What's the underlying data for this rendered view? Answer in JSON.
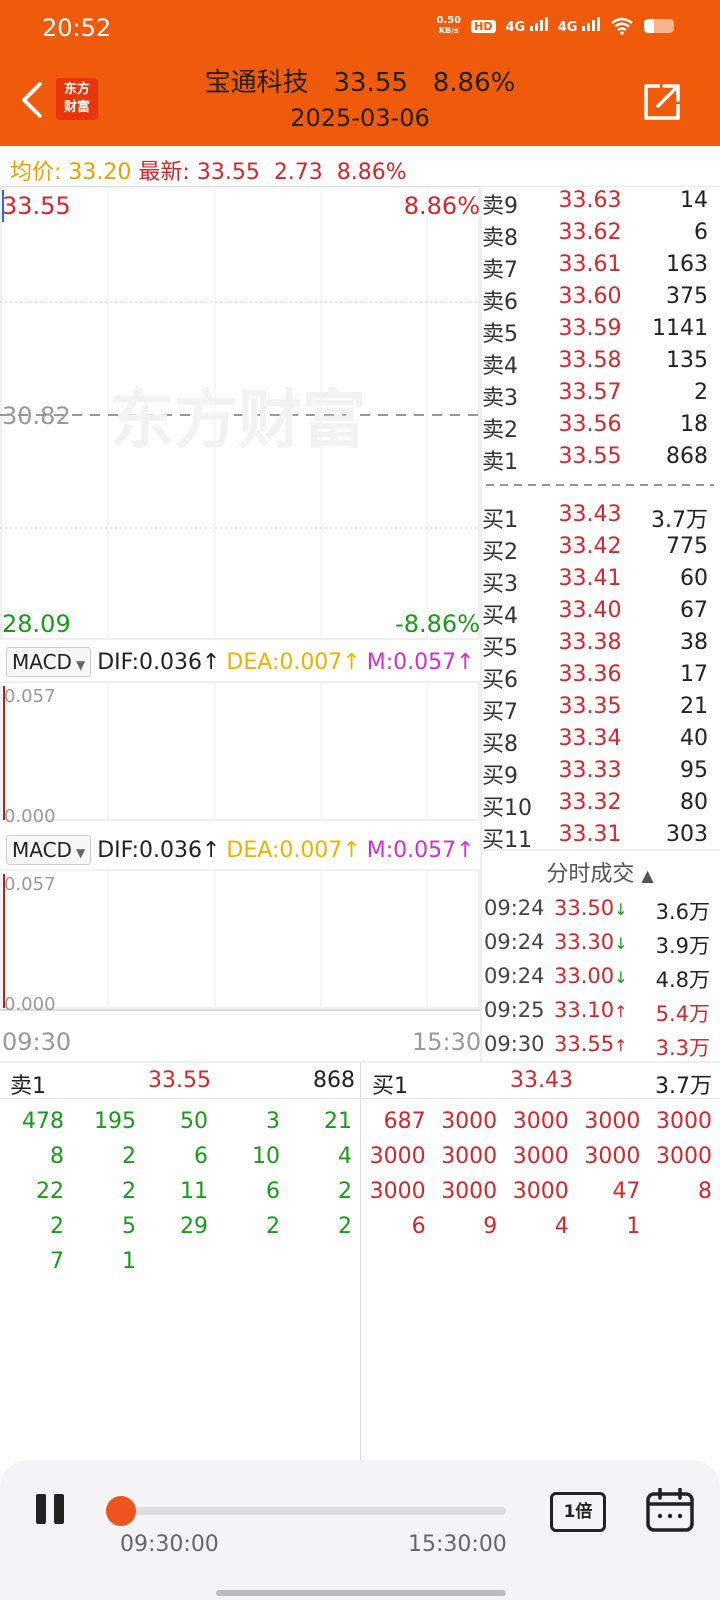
{
  "status": {
    "time": "20:52",
    "net_speed": "0.50",
    "net_unit": "KB/s",
    "hd_label": "HD",
    "sim_1": "4G",
    "sim_2": "4G"
  },
  "header": {
    "logo_line1": "东方",
    "logo_line2": "财富",
    "stock_name": "宝通科技",
    "price": "33.55",
    "change_pct": "8.86%",
    "date": "2025-03-06",
    "back_icon": "chevron-left-icon",
    "share_icon": "share-external-icon"
  },
  "infoline": {
    "avg_label": "均价:",
    "avg_value": "33.20",
    "latest_label": "最新:",
    "latest_value": "33.55",
    "change": "2.73",
    "change_pct": "8.86%"
  },
  "chart": {
    "watermark": "东方财富",
    "top_price": "33.55",
    "top_pct": "8.86%",
    "mid_price": "30.82",
    "low_price": "28.09",
    "low_pct": "-8.86%",
    "time_start": "09:30",
    "time_end": "15:30",
    "colors": {
      "up": "#d0282c",
      "down": "#1a9a1a",
      "avg": "#e8a100"
    }
  },
  "macd": [
    {
      "name": "MACD",
      "dif": "DIF:0.036",
      "dea": "DEA:0.007",
      "m": "M:0.057",
      "high": "0.057",
      "low": "0.000"
    },
    {
      "name": "MACD",
      "dif": "DIF:0.036",
      "dea": "DEA:0.007",
      "m": "M:0.057",
      "high": "0.057",
      "low": "0.000"
    }
  ],
  "order_book": {
    "asks": [
      {
        "label": "卖9",
        "price": "33.63",
        "vol": "14"
      },
      {
        "label": "卖8",
        "price": "33.62",
        "vol": "6"
      },
      {
        "label": "卖7",
        "price": "33.61",
        "vol": "163"
      },
      {
        "label": "卖6",
        "price": "33.60",
        "vol": "375"
      },
      {
        "label": "卖5",
        "price": "33.59",
        "vol": "1141"
      },
      {
        "label": "卖4",
        "price": "33.58",
        "vol": "135"
      },
      {
        "label": "卖3",
        "price": "33.57",
        "vol": "2"
      },
      {
        "label": "卖2",
        "price": "33.56",
        "vol": "18"
      },
      {
        "label": "卖1",
        "price": "33.55",
        "vol": "868"
      }
    ],
    "bids": [
      {
        "label": "买1",
        "price": "33.43",
        "vol": "3.7万"
      },
      {
        "label": "买2",
        "price": "33.42",
        "vol": "775"
      },
      {
        "label": "买3",
        "price": "33.41",
        "vol": "60"
      },
      {
        "label": "买4",
        "price": "33.40",
        "vol": "67"
      },
      {
        "label": "买5",
        "price": "33.38",
        "vol": "38"
      },
      {
        "label": "买6",
        "price": "33.36",
        "vol": "17"
      },
      {
        "label": "买7",
        "price": "33.35",
        "vol": "21"
      },
      {
        "label": "买8",
        "price": "33.34",
        "vol": "40"
      },
      {
        "label": "买9",
        "price": "33.33",
        "vol": "95"
      },
      {
        "label": "买10",
        "price": "33.32",
        "vol": "80"
      },
      {
        "label": "买11",
        "price": "33.31",
        "vol": "303"
      }
    ]
  },
  "trades": {
    "title": "分时成交",
    "rows": [
      {
        "time": "09:24",
        "price": "33.50",
        "dir": "down",
        "vol": "3.6万",
        "vol_color": "#222222"
      },
      {
        "time": "09:24",
        "price": "33.30",
        "dir": "down",
        "vol": "3.9万",
        "vol_color": "#222222"
      },
      {
        "time": "09:24",
        "price": "33.00",
        "dir": "down",
        "vol": "4.8万",
        "vol_color": "#222222"
      },
      {
        "time": "09:25",
        "price": "33.10",
        "dir": "up",
        "vol": "5.4万",
        "vol_color": "#d0282c"
      },
      {
        "time": "09:30",
        "price": "33.55",
        "dir": "up",
        "vol": "3.3万",
        "vol_color": "#d0282c"
      }
    ]
  },
  "queue": {
    "sell": {
      "label": "卖1",
      "price": "33.55",
      "vol": "868",
      "items": [
        "478",
        "195",
        "50",
        "3",
        "21",
        "8",
        "2",
        "6",
        "10",
        "4",
        "22",
        "2",
        "11",
        "6",
        "2",
        "2",
        "5",
        "29",
        "2",
        "2",
        "7",
        "1"
      ]
    },
    "buy": {
      "label": "买1",
      "price": "33.43",
      "vol": "3.7万",
      "items": [
        "687",
        "3000",
        "3000",
        "3000",
        "3000",
        "3000",
        "3000",
        "3000",
        "3000",
        "3000",
        "3000",
        "3000",
        "3000",
        "47",
        "8",
        "6",
        "9",
        "4",
        "1"
      ]
    }
  },
  "player": {
    "start_time": "09:30:00",
    "end_time": "15:30:00",
    "speed": "1倍",
    "progress": 0
  }
}
